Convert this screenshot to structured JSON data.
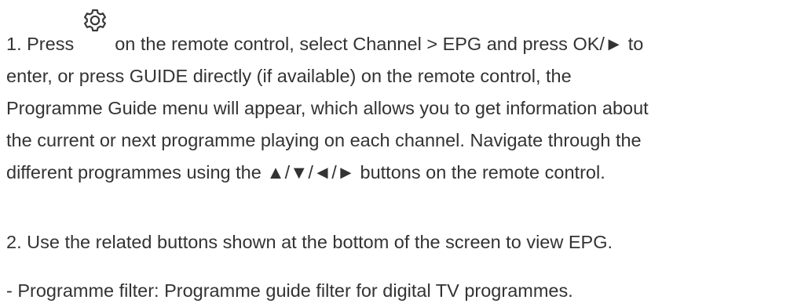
{
  "document": {
    "step1": {
      "prefix": "1. Press",
      "icon": "settings-gear-icon",
      "line1_rest": "on the remote control, select Channel > EPG and press OK/► to",
      "line2": "enter, or press GUIDE directly (if available) on the remote control, the",
      "line3": "Programme Guide menu will appear, which allows you to get information about",
      "line4": "the current or next programme playing on each channel. Navigate through the",
      "line5": "different programmes using the ▲/▼/◄/► buttons on the remote control."
    },
    "step2": "2. Use the related buttons shown at the bottom of the screen to view EPG.",
    "bullet1": "- Programme filter: Programme guide filter for digital TV programmes."
  }
}
